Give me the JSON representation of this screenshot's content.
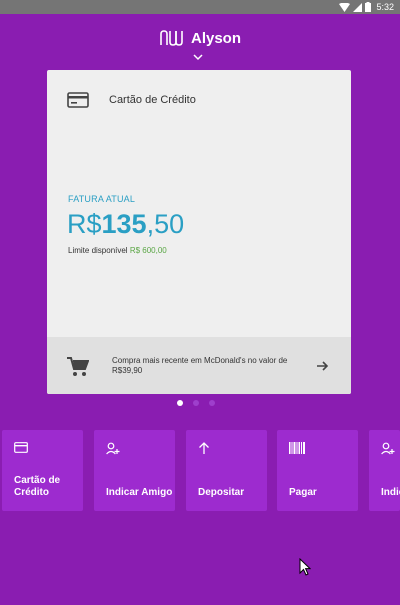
{
  "status_bar": {
    "time": "5:32"
  },
  "header": {
    "user_name": "Alyson"
  },
  "card": {
    "title": "Cartão de Crédito",
    "invoice_label": "FATURA ATUAL",
    "amount_currency": "R$",
    "amount_integer": "135",
    "amount_decimal": ",50",
    "limit_label": "Limite disponível",
    "limit_value": "R$ 600,00",
    "recent_purchase": "Compra mais recente em McDonald's no valor de R$39,90"
  },
  "pager": {
    "count": 3,
    "active_index": 0
  },
  "shortcuts": [
    {
      "label": "Cartão de Crédito",
      "icon": "credit-card-icon"
    },
    {
      "label": "Indicar Amigo",
      "icon": "add-person-icon"
    },
    {
      "label": "Depositar",
      "icon": "arrow-up-icon"
    },
    {
      "label": "Pagar",
      "icon": "barcode-icon"
    },
    {
      "label": "Indicar Amigo",
      "icon": "add-person-icon"
    }
  ],
  "colors": {
    "background": "#8a1db1",
    "accent": "#2a9fc4",
    "limit": "#5aa645",
    "tile": "#9d2bcf"
  }
}
